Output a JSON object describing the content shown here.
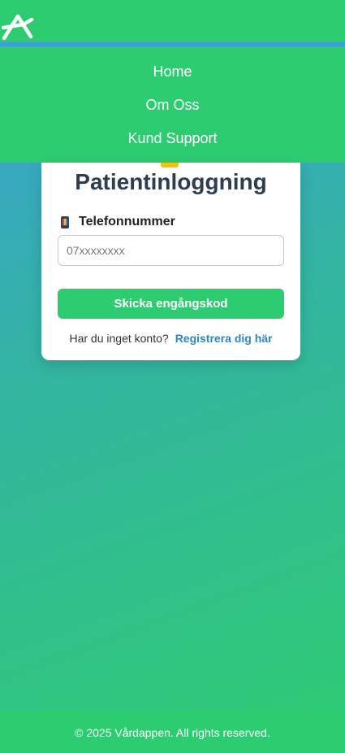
{
  "nav": {
    "items": [
      {
        "label": "Home"
      },
      {
        "label": "Om Oss"
      },
      {
        "label": "Kund Support"
      }
    ]
  },
  "login": {
    "title": "Patientinloggning",
    "phone_label": "Telefonnummer",
    "phone_icon": "mobile-phone-icon",
    "phone_placeholder": "07xxxxxxxx",
    "phone_value": "",
    "submit_label": "Skicka engångskod",
    "no_account_text": "Har du inget konto?",
    "register_link": "Registrera dig här"
  },
  "footer": {
    "text": "© 2025 Vårdappen. All rights reserved."
  },
  "colors": {
    "brand_green": "#2ecc71",
    "accent_blue": "#3c9fd9",
    "title_dark": "#2c3e50",
    "link_blue": "#2e86c1",
    "accent_yellow": "#f1c40f"
  }
}
